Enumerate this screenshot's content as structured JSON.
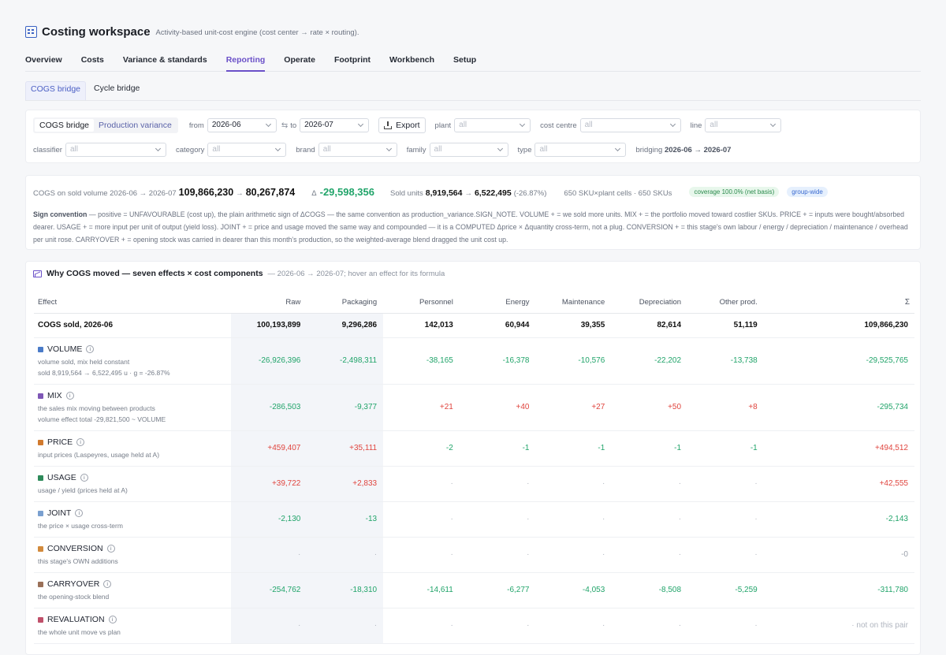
{
  "app": {
    "title": "Costing workspace",
    "subtitle": "Activity-based unit-cost engine (cost center → rate × routing)."
  },
  "tabs": [
    "Overview",
    "Costs",
    "Variance & standards",
    "Reporting",
    "Operate",
    "Footprint",
    "Workbench",
    "Setup"
  ],
  "active_tab": "Reporting",
  "subtabs": [
    "COGS bridge",
    "Cycle bridge"
  ],
  "active_subtab": "COGS bridge",
  "filters": {
    "mode_options": [
      "COGS bridge",
      "Production variance"
    ],
    "from_label": "from",
    "from_value": "2026-06",
    "to_label": "to",
    "to_value": "2026-07",
    "export_label": "Export",
    "plant_label": "plant",
    "cost_centre_label": "cost centre",
    "line_label": "line",
    "classifier_label": "classifier",
    "category_label": "category",
    "brand_label": "brand",
    "family_label": "family",
    "type_label": "type",
    "all_placeholder": "all",
    "bridging_label": "bridging",
    "bridging_value": "2026-06 → 2026-07"
  },
  "summary": {
    "cogs_label": "COGS on sold volume 2026-06 → 2026-07",
    "cogs_from": "109,866,230",
    "arrow": "→",
    "cogs_to": "80,267,874",
    "delta_prefix": "Δ",
    "delta_value": "-29,598,356",
    "units_label": "Sold units",
    "units_from": "8,919,564",
    "units_to": "6,522,495",
    "units_pct": "(-26.87%)",
    "cells_text": "650 SKU×plant cells · 650 SKUs",
    "coverage_badge": "coverage 100.0% (net basis)",
    "scope_badge": "group-wide",
    "sign_title": "Sign convention",
    "sign_text": " — positive = UNFAVOURABLE (cost up), the plain arithmetic sign of ΔCOGS — the same convention as production_variance.SIGN_NOTE. VOLUME + = we sold more units. MIX + = the portfolio moved toward costlier SKUs. PRICE + = inputs were bought/absorbed dearer. USAGE + = more input per unit of output (yield loss). JOINT + = price and usage moved the same way and compounded — it is a COMPUTED Δprice × Δquantity cross-term, not a plug. CONVERSION + = this stage's own labour / energy / depreciation / maintenance / overhead per unit rose. CARRYOVER + = opening stock was carried in dearer than this month's production, so the weighted-average blend dragged the unit cost up."
  },
  "effects_panel": {
    "title": "Why COGS moved — seven effects × cost components",
    "subtitle": "— 2026-06 → 2026-07; hover an effect for its formula",
    "columns": [
      "Effect",
      "Raw",
      "Packaging",
      "Personnel",
      "Energy",
      "Maintenance",
      "Depreciation",
      "Other prod.",
      "Σ"
    ],
    "base_row": {
      "label": "COGS sold, 2026-06",
      "values": [
        "100,193,899",
        "9,296,286",
        "142,013",
        "60,944",
        "39,355",
        "82,614",
        "51,119",
        "109,866,230"
      ]
    },
    "rows": [
      {
        "name": "VOLUME",
        "color": "#4a7bc8",
        "desc": "volume sold, mix held constant",
        "detail": "sold 8,919,564 → 6,522,495 u · g = -26.87%",
        "values": [
          "-26,926,396",
          "-2,498,311",
          "-38,165",
          "-16,378",
          "-10,576",
          "-22,202",
          "-13,738",
          "-29,525,765"
        ]
      },
      {
        "name": "MIX",
        "color": "#7e57b6",
        "desc": "the sales mix moving between products",
        "detail": "volume effect total -29,821,500 ~ VOLUME",
        "values": [
          "-286,503",
          "-9,377",
          "+21",
          "+40",
          "+27",
          "+50",
          "+8",
          "-295,734"
        ]
      },
      {
        "name": "PRICE",
        "color": "#d17a2e",
        "desc": "input prices (Laspeyres, usage held at A)",
        "detail": "",
        "values": [
          "+459,407",
          "+35,111",
          "-2",
          "-1",
          "-1",
          "-1",
          "-1",
          "+494,512"
        ]
      },
      {
        "name": "USAGE",
        "color": "#2e8a5a",
        "desc": "usage / yield (prices held at A)",
        "detail": "",
        "values": [
          "+39,722",
          "+2,833",
          "·",
          "·",
          "·",
          "·",
          "·",
          "+42,555"
        ]
      },
      {
        "name": "JOINT",
        "color": "#7aa0d0",
        "desc": "the price × usage cross-term",
        "detail": "",
        "values": [
          "-2,130",
          "-13",
          "·",
          "·",
          "·",
          "·",
          "·",
          "-2,143"
        ]
      },
      {
        "name": "CONVERSION",
        "color": "#d28a3c",
        "desc": "this stage's OWN additions",
        "detail": "",
        "values": [
          "·",
          "·",
          "·",
          "·",
          "·",
          "·",
          "·",
          "-0"
        ]
      },
      {
        "name": "CARRYOVER",
        "color": "#9a7058",
        "desc": "the opening-stock blend",
        "detail": "",
        "values": [
          "-254,762",
          "-18,310",
          "-14,611",
          "-6,277",
          "-4,053",
          "-8,508",
          "-5,259",
          "-311,780"
        ]
      },
      {
        "name": "REVALUATION",
        "color": "#c0506a",
        "desc": "the whole unit move vs plan",
        "detail": "",
        "values": [
          "·",
          "·",
          "·",
          "·",
          "·",
          "·",
          "·",
          "· not on this pair"
        ]
      }
    ]
  },
  "colors": {
    "accent": "#6a50c8",
    "favourable": "#21a46a",
    "unfavourable": "#e0453f"
  }
}
